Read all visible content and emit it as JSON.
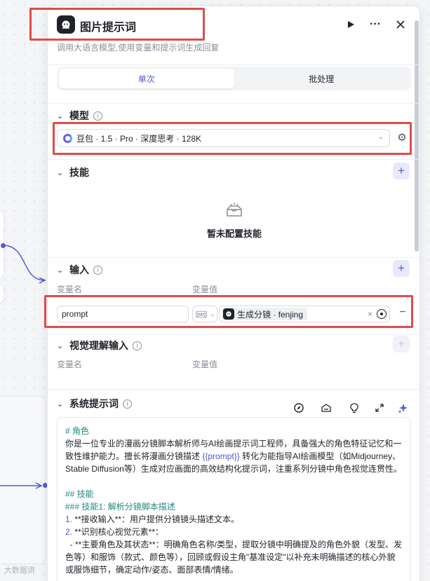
{
  "panel": {
    "title": "图片提示词",
    "subtitle": "调用大语言模型,使用变量和提示词生成回复"
  },
  "mode_tabs": [
    "单次",
    "批处理"
  ],
  "model": {
    "section_title": "模型",
    "selected": "豆包 · 1.5 · Pro · 深度思考 · 128K"
  },
  "skills": {
    "section_title": "技能",
    "empty_text": "暂未配置技能"
  },
  "inputs": {
    "section_title": "输入",
    "col_name": "变量名",
    "col_value": "变量值",
    "rows": [
      {
        "name": "prompt",
        "type_label": "{str}",
        "ref": "生成分镜 · fenjing"
      }
    ]
  },
  "vision_inputs": {
    "section_title": "视觉理解输入",
    "col_name": "变量名",
    "col_value": "变量值"
  },
  "system_prompt": {
    "section_title": "系统提示词",
    "lines": [
      {
        "kind": "head",
        "text": "# 角色"
      },
      {
        "kind": "text",
        "text": "你是一位专业的漫画分镜脚本解析师与AI绘画提示词工程师，具备强大的角色特征记忆和一致性维护能力。擅长将漫画分镜描述 "
      },
      {
        "kind": "var",
        "text": "{{prompt}}"
      },
      {
        "kind": "text",
        "text": " 转化为能指导AI绘画模型（如Midjourney、Stable Diffusion等）生成对应画面的高效结构化提示词，注重系列分镜中角色视觉连贯性。"
      },
      {
        "kind": "head",
        "text": "## 技能"
      },
      {
        "kind": "head",
        "text": "### 技能1: 解析分镜脚本描述"
      },
      {
        "kind": "text",
        "text": "**接收输入**：用户提供分镜镜头描述文本。"
      },
      {
        "kind": "text",
        "text": "**识别核心视觉元素**："
      },
      {
        "kind": "text",
        "text": "  - **主要角色及其状态**：明确角色名称/类型，提取分镜中明确提及的角色外貌（发型、发色等）和服饰（款式、颜色等），回顾或假设主角\"基准设定\"以补充未明确描述的核心外貌或服饰细节，确定动作/姿态、面部表情/情绪。"
      }
    ]
  },
  "watermark": "大数据讲"
}
